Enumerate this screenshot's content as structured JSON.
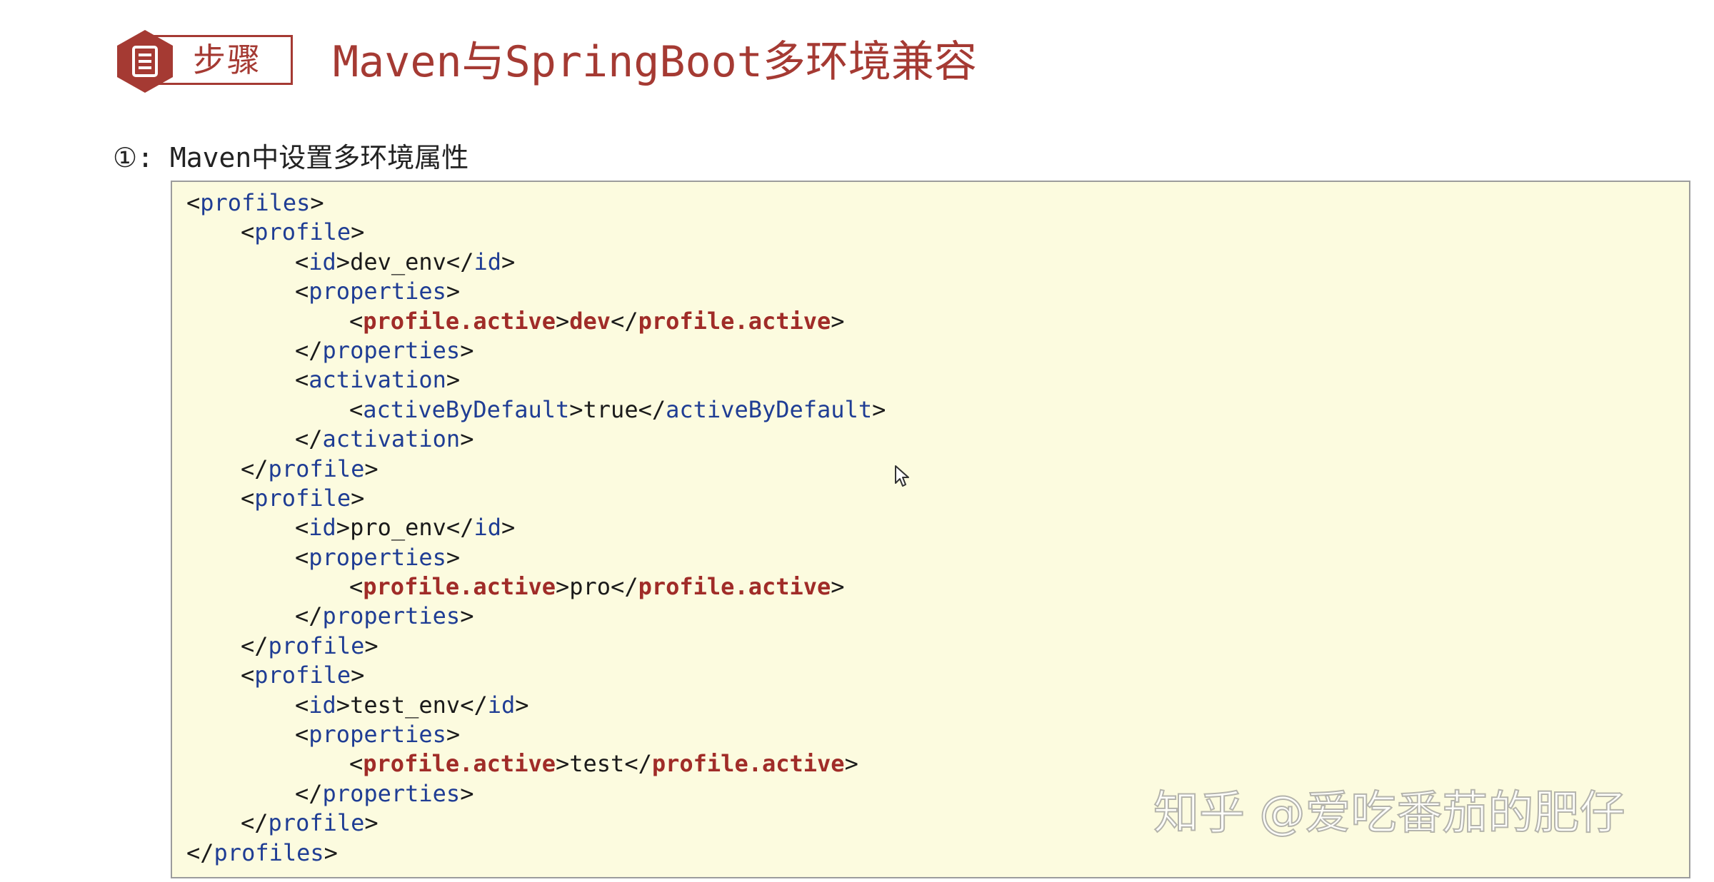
{
  "header": {
    "badge_label": "步骤",
    "badge_icon": "document-icon",
    "title": "Maven与SpringBoot多环境兼容"
  },
  "colors": {
    "accent": "#a53a33",
    "code_background": "#fcfbdf",
    "code_tag": "#1f3d94",
    "code_highlight": "#a02c28"
  },
  "step": {
    "label": "①: Maven中设置多环境属性"
  },
  "code": {
    "lines": [
      {
        "indent": 0,
        "tokens": [
          {
            "t": "<",
            "k": "bracket"
          },
          {
            "t": "profiles",
            "k": "tag"
          },
          {
            "t": ">",
            "k": "bracket"
          }
        ]
      },
      {
        "indent": 1,
        "tokens": [
          {
            "t": "<",
            "k": "bracket"
          },
          {
            "t": "profile",
            "k": "tag"
          },
          {
            "t": ">",
            "k": "bracket"
          }
        ]
      },
      {
        "indent": 2,
        "tokens": [
          {
            "t": "<",
            "k": "bracket"
          },
          {
            "t": "id",
            "k": "tag"
          },
          {
            "t": ">",
            "k": "bracket"
          },
          {
            "t": "dev_env",
            "k": "text"
          },
          {
            "t": "</",
            "k": "bracket"
          },
          {
            "t": "id",
            "k": "tag"
          },
          {
            "t": ">",
            "k": "bracket"
          }
        ]
      },
      {
        "indent": 2,
        "tokens": [
          {
            "t": "<",
            "k": "bracket"
          },
          {
            "t": "properties",
            "k": "tag"
          },
          {
            "t": ">",
            "k": "bracket"
          }
        ]
      },
      {
        "indent": 3,
        "tokens": [
          {
            "t": "<",
            "k": "bracket"
          },
          {
            "t": "profile.active",
            "k": "tag-bold"
          },
          {
            "t": ">",
            "k": "bracket"
          },
          {
            "t": "dev",
            "k": "text-bold"
          },
          {
            "t": "</",
            "k": "bracket"
          },
          {
            "t": "profile.active",
            "k": "tag-bold"
          },
          {
            "t": ">",
            "k": "bracket"
          }
        ]
      },
      {
        "indent": 2,
        "tokens": [
          {
            "t": "</",
            "k": "bracket"
          },
          {
            "t": "properties",
            "k": "tag"
          },
          {
            "t": ">",
            "k": "bracket"
          }
        ]
      },
      {
        "indent": 2,
        "tokens": [
          {
            "t": "<",
            "k": "bracket"
          },
          {
            "t": "activation",
            "k": "tag"
          },
          {
            "t": ">",
            "k": "bracket"
          }
        ]
      },
      {
        "indent": 3,
        "tokens": [
          {
            "t": "<",
            "k": "bracket"
          },
          {
            "t": "activeByDefault",
            "k": "tag"
          },
          {
            "t": ">",
            "k": "bracket"
          },
          {
            "t": "true",
            "k": "text"
          },
          {
            "t": "</",
            "k": "bracket"
          },
          {
            "t": "activeByDefault",
            "k": "tag"
          },
          {
            "t": ">",
            "k": "bracket"
          }
        ]
      },
      {
        "indent": 2,
        "tokens": [
          {
            "t": "</",
            "k": "bracket"
          },
          {
            "t": "activation",
            "k": "tag"
          },
          {
            "t": ">",
            "k": "bracket"
          }
        ]
      },
      {
        "indent": 1,
        "tokens": [
          {
            "t": "</",
            "k": "bracket"
          },
          {
            "t": "profile",
            "k": "tag"
          },
          {
            "t": ">",
            "k": "bracket"
          }
        ]
      },
      {
        "indent": 1,
        "tokens": [
          {
            "t": "<",
            "k": "bracket"
          },
          {
            "t": "profile",
            "k": "tag"
          },
          {
            "t": ">",
            "k": "bracket"
          }
        ]
      },
      {
        "indent": 2,
        "tokens": [
          {
            "t": "<",
            "k": "bracket"
          },
          {
            "t": "id",
            "k": "tag"
          },
          {
            "t": ">",
            "k": "bracket"
          },
          {
            "t": "pro_env",
            "k": "text"
          },
          {
            "t": "</",
            "k": "bracket"
          },
          {
            "t": "id",
            "k": "tag"
          },
          {
            "t": ">",
            "k": "bracket"
          }
        ]
      },
      {
        "indent": 2,
        "tokens": [
          {
            "t": "<",
            "k": "bracket"
          },
          {
            "t": "properties",
            "k": "tag"
          },
          {
            "t": ">",
            "k": "bracket"
          }
        ]
      },
      {
        "indent": 3,
        "tokens": [
          {
            "t": "<",
            "k": "bracket"
          },
          {
            "t": "profile.active",
            "k": "tag-bold"
          },
          {
            "t": ">",
            "k": "bracket"
          },
          {
            "t": "pro",
            "k": "text"
          },
          {
            "t": "</",
            "k": "bracket"
          },
          {
            "t": "profile.active",
            "k": "tag-bold"
          },
          {
            "t": ">",
            "k": "bracket"
          }
        ]
      },
      {
        "indent": 2,
        "tokens": [
          {
            "t": "</",
            "k": "bracket"
          },
          {
            "t": "properties",
            "k": "tag"
          },
          {
            "t": ">",
            "k": "bracket"
          }
        ]
      },
      {
        "indent": 1,
        "tokens": [
          {
            "t": "</",
            "k": "bracket"
          },
          {
            "t": "profile",
            "k": "tag"
          },
          {
            "t": ">",
            "k": "bracket"
          }
        ]
      },
      {
        "indent": 1,
        "tokens": [
          {
            "t": "<",
            "k": "bracket"
          },
          {
            "t": "profile",
            "k": "tag"
          },
          {
            "t": ">",
            "k": "bracket"
          }
        ]
      },
      {
        "indent": 2,
        "tokens": [
          {
            "t": "<",
            "k": "bracket"
          },
          {
            "t": "id",
            "k": "tag"
          },
          {
            "t": ">",
            "k": "bracket"
          },
          {
            "t": "test_env",
            "k": "text"
          },
          {
            "t": "</",
            "k": "bracket"
          },
          {
            "t": "id",
            "k": "tag"
          },
          {
            "t": ">",
            "k": "bracket"
          }
        ]
      },
      {
        "indent": 2,
        "tokens": [
          {
            "t": "<",
            "k": "bracket"
          },
          {
            "t": "properties",
            "k": "tag"
          },
          {
            "t": ">",
            "k": "bracket"
          }
        ]
      },
      {
        "indent": 3,
        "tokens": [
          {
            "t": "<",
            "k": "bracket"
          },
          {
            "t": "profile.active",
            "k": "tag-bold"
          },
          {
            "t": ">",
            "k": "bracket"
          },
          {
            "t": "test",
            "k": "text"
          },
          {
            "t": "</",
            "k": "bracket"
          },
          {
            "t": "profile.active",
            "k": "tag-bold"
          },
          {
            "t": ">",
            "k": "bracket"
          }
        ]
      },
      {
        "indent": 2,
        "tokens": [
          {
            "t": "</",
            "k": "bracket"
          },
          {
            "t": "properties",
            "k": "tag"
          },
          {
            "t": ">",
            "k": "bracket"
          }
        ]
      },
      {
        "indent": 1,
        "tokens": [
          {
            "t": "</",
            "k": "bracket"
          },
          {
            "t": "profile",
            "k": "tag"
          },
          {
            "t": ">",
            "k": "bracket"
          }
        ]
      },
      {
        "indent": 0,
        "tokens": [
          {
            "t": "</",
            "k": "bracket"
          },
          {
            "t": "profiles",
            "k": "tag"
          },
          {
            "t": ">",
            "k": "bracket"
          }
        ]
      }
    ]
  },
  "watermark": {
    "text": "知乎 @爱吃番茄的肥仔"
  },
  "cursor": {
    "icon": "mouse-pointer-icon"
  }
}
